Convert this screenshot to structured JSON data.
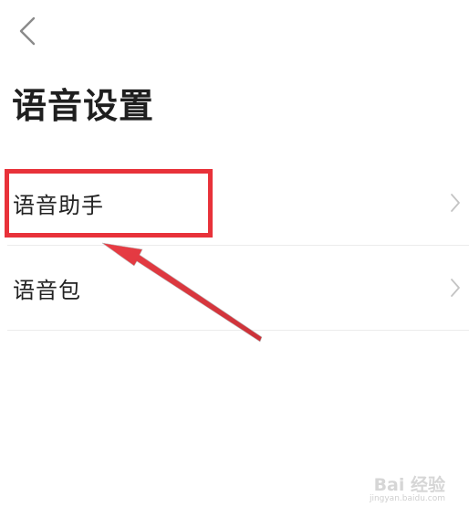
{
  "header": {
    "back_icon": "chevron-left-icon"
  },
  "page": {
    "title": "语音设置"
  },
  "settings": {
    "items": [
      {
        "label": "语音助手",
        "icon": "chevron-right-icon"
      },
      {
        "label": "语音包",
        "icon": "chevron-right-icon"
      }
    ]
  },
  "annotation": {
    "highlight_color": "#e8323a",
    "arrow_color": "#e8323a"
  },
  "watermark": {
    "text": "Bai 经验",
    "url": "jingyan.baidu.com"
  }
}
